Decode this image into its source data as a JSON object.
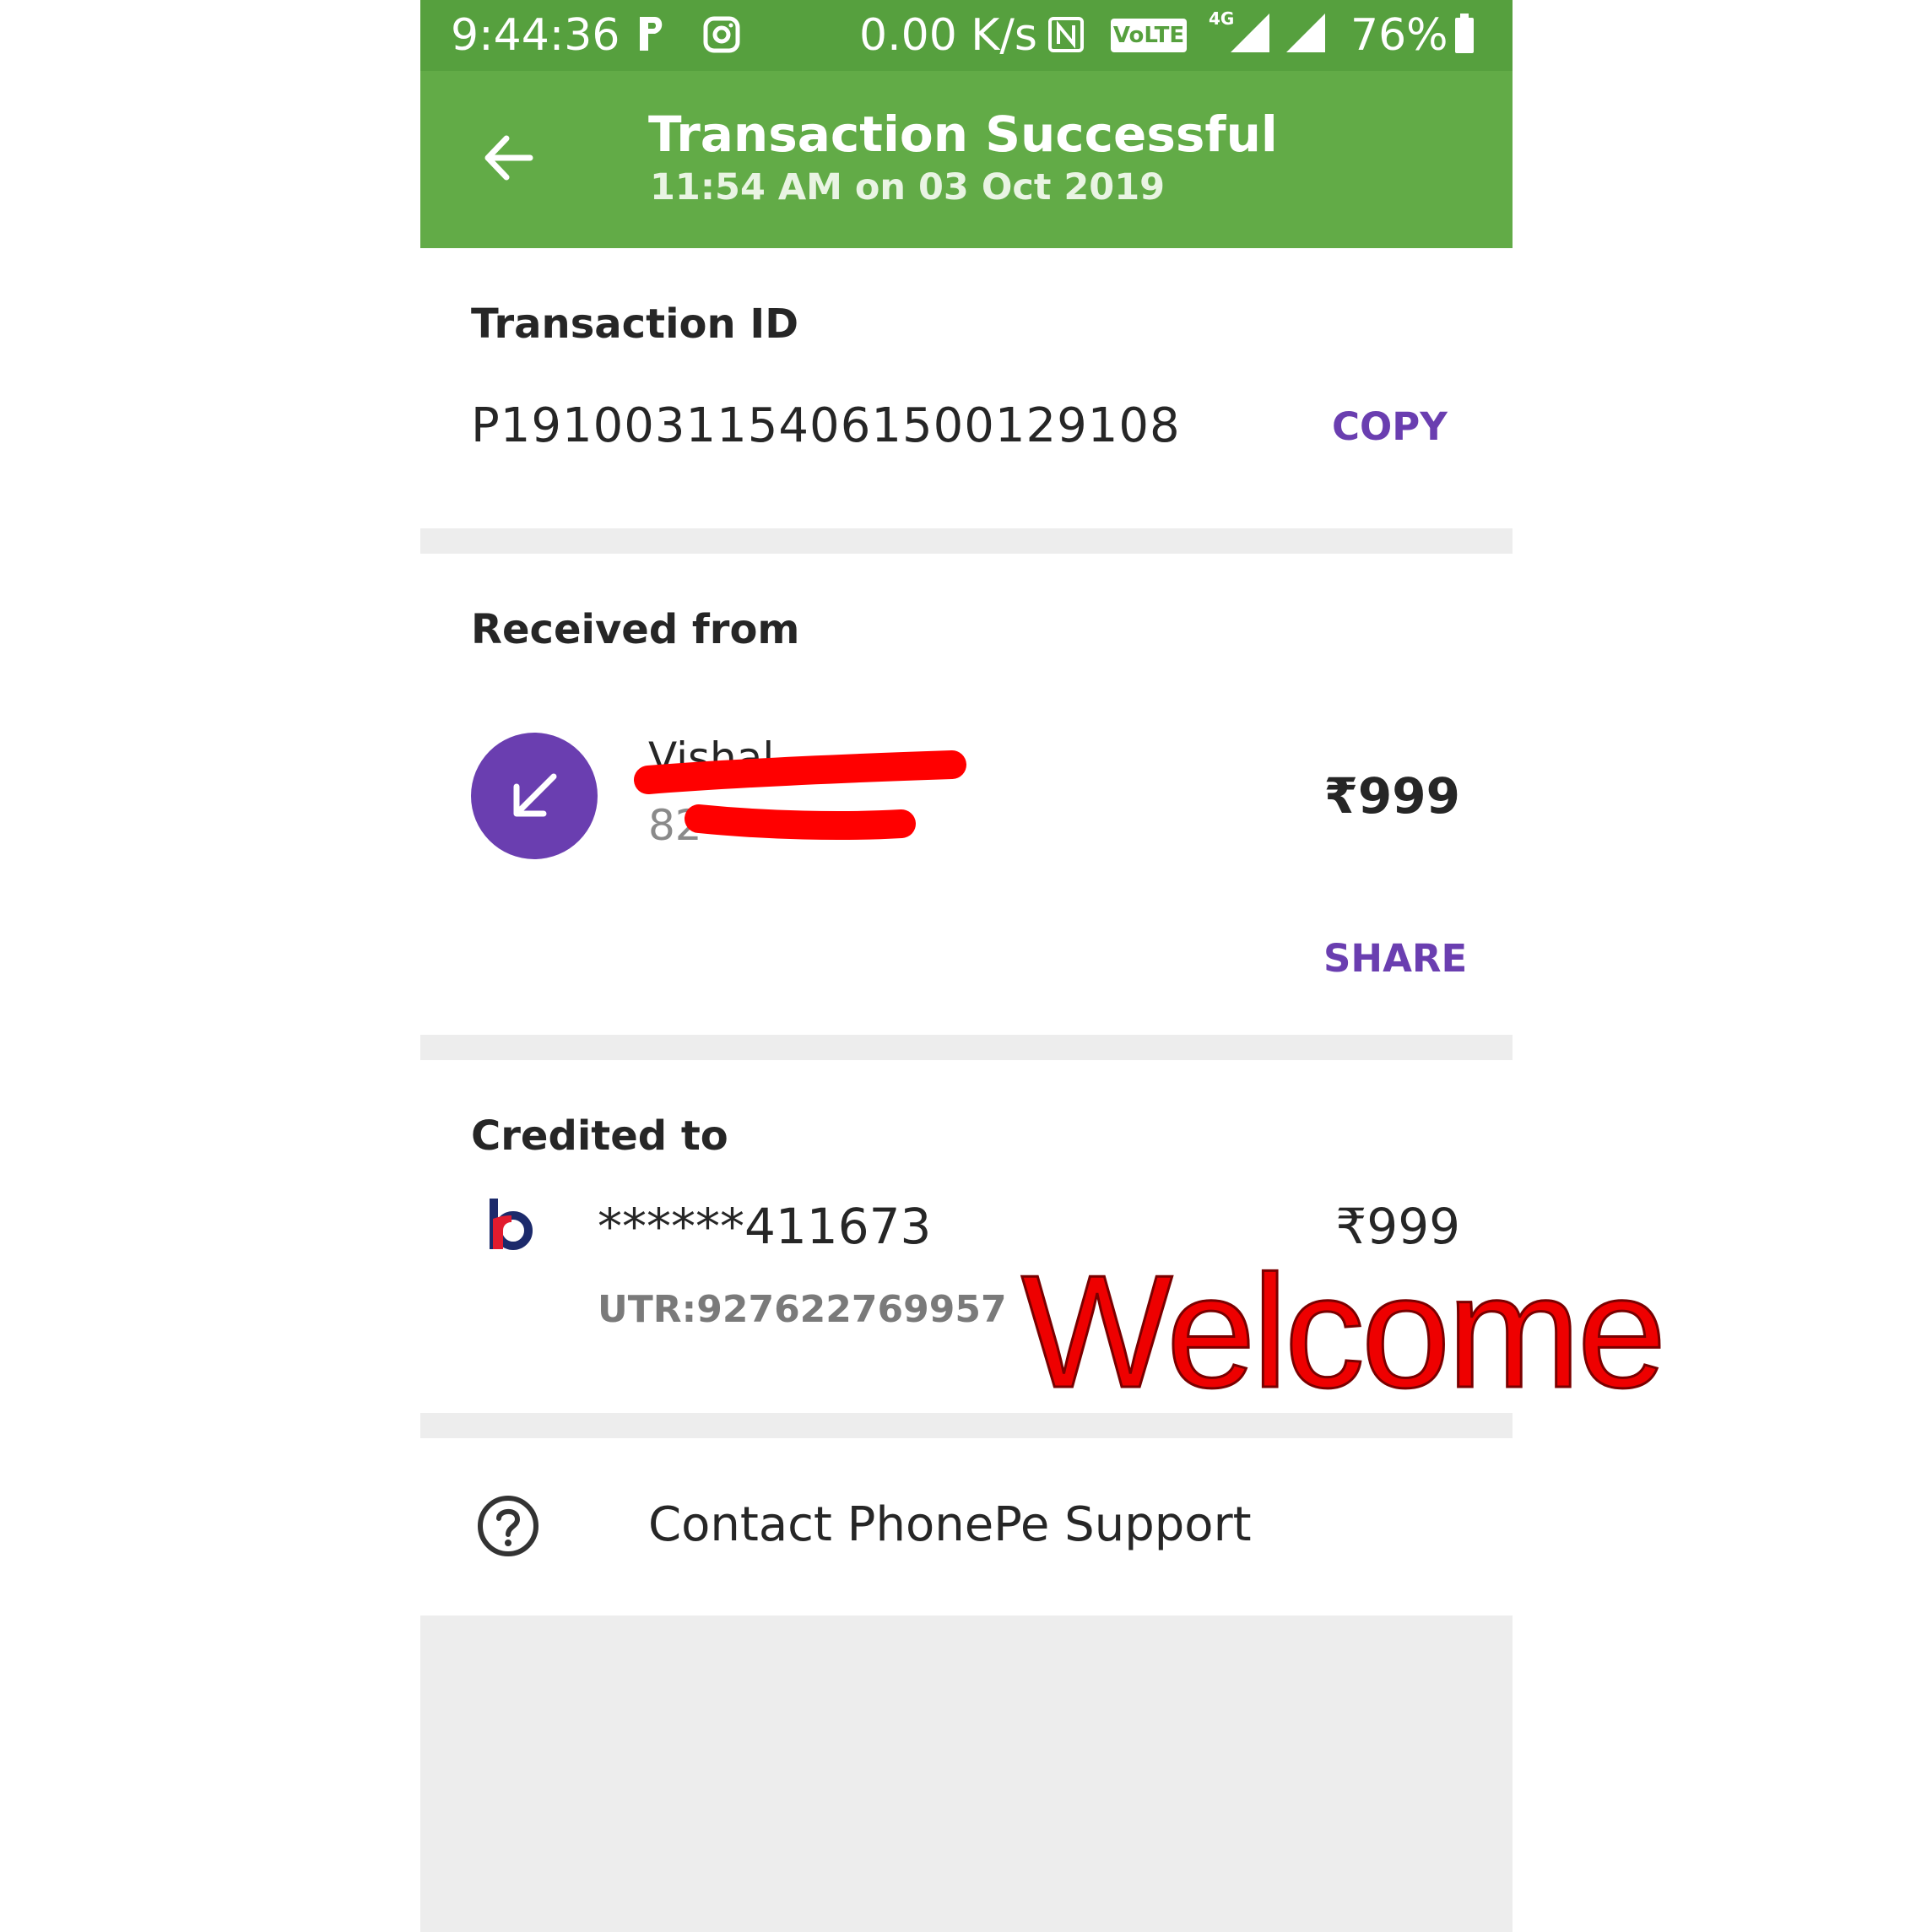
{
  "status_bar": {
    "time": "9:44:36",
    "network_speed": "0.00 K/s",
    "volte_label": "VoLTE",
    "network_type": "4G",
    "battery_percent": "76%",
    "icons": [
      "parking-app-icon",
      "instagram-icon",
      "nfc-icon",
      "volte-icon",
      "signal-icon",
      "signal-icon",
      "battery-icon"
    ]
  },
  "app_bar": {
    "title": "Transaction Successful",
    "subtitle": "11:54 AM on 03 Oct 2019",
    "back_icon": "arrow-left-icon"
  },
  "transaction": {
    "label": "Transaction ID",
    "id": "P1910031154061500129108",
    "copy_label": "COPY"
  },
  "received_from": {
    "label": "Received from",
    "name": "Vishal",
    "phone": "82",
    "amount": "₹999",
    "share_label": "SHARE",
    "avatar_icon": "arrow-down-left-icon"
  },
  "credited_to": {
    "label": "Credited to",
    "account": "******411673",
    "amount": "₹999",
    "utr": "UTR:927622769957",
    "bank_icon": "bank-logo-icon"
  },
  "support": {
    "label": "Contact PhonePe Support",
    "icon": "help-circle-icon"
  },
  "overlay": {
    "text": "Welcome"
  },
  "colors": {
    "status_bar": "#56a03e",
    "app_bar": "#62ab47",
    "accent": "#6a3eb0",
    "divider": "#ededed",
    "overlay_text": "#ee0000"
  }
}
